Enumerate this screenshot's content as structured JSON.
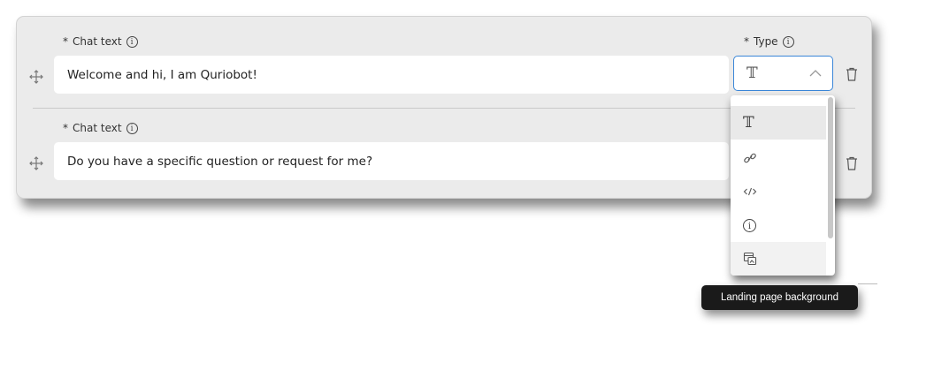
{
  "rows": [
    {
      "label_star": "*",
      "label": "Chat text",
      "value": "Welcome and hi, I am Quriobot!"
    },
    {
      "label_star": "*",
      "label": "Chat text",
      "value": "Do you have a specific question or request for me?"
    }
  ],
  "type_field": {
    "label_star": "*",
    "label": "Type",
    "selected_icon": "text-type-icon"
  },
  "dropdown": {
    "options": [
      {
        "icon": "text-type-icon",
        "selected": true
      },
      {
        "icon": "link-icon"
      },
      {
        "icon": "code-icon"
      },
      {
        "icon": "info-icon"
      },
      {
        "icon": "landing-page-background-icon",
        "hovered": true
      }
    ],
    "tooltip": "Landing page background"
  },
  "colors": {
    "card_bg": "#ebebeb",
    "focus_border": "#3a86d8",
    "tooltip_bg": "#1a1a1a"
  }
}
